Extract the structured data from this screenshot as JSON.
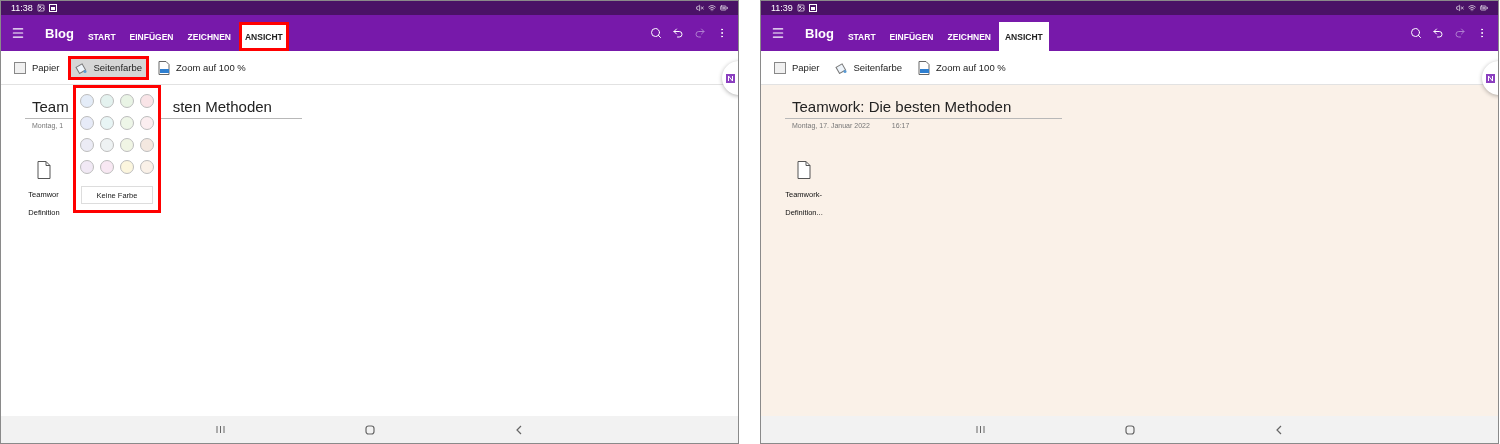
{
  "screens": [
    {
      "status_bar": {
        "time": "11:38"
      },
      "app_bar": {
        "title": "Blog",
        "tabs": [
          {
            "label": "START",
            "selected": false,
            "highlighted": false
          },
          {
            "label": "EINFÜGEN",
            "selected": false,
            "highlighted": false
          },
          {
            "label": "ZEICHNEN",
            "selected": false,
            "highlighted": false
          },
          {
            "label": "ANSICHT",
            "selected": true,
            "highlighted": true
          }
        ],
        "actions": [
          {
            "kind": "search",
            "disabled": false
          },
          {
            "kind": "undo",
            "disabled": false
          },
          {
            "kind": "redo",
            "disabled": true
          },
          {
            "kind": "more",
            "disabled": false
          }
        ]
      },
      "ribbon": [
        {
          "kind": "paper",
          "label": "Papier",
          "highlighted": false
        },
        {
          "kind": "page_color",
          "label": "Seitenfarbe",
          "highlighted": true
        },
        {
          "kind": "zoom",
          "label": "Zoom auf 100 %",
          "highlighted": false
        }
      ],
      "page": {
        "color": "#ffffff",
        "title_segments": [
          "Team",
          "sten Methoden"
        ],
        "date": "Montag, 1",
        "attachment": {
          "lines": [
            "Teamwor",
            "Definition"
          ]
        }
      },
      "color_popup": {
        "highlighted": true,
        "button": "Keine Farbe",
        "swatches": [
          {
            "color": "#e4ecf8"
          },
          {
            "color": "#e4f2ef"
          },
          {
            "color": "#e9f4e5"
          },
          {
            "color": "#f9e4e7"
          },
          {
            "color": "#e7ebf8"
          },
          {
            "color": "#e8f5f5"
          },
          {
            "color": "#eef6e8"
          },
          {
            "color": "#fbeef0"
          },
          {
            "color": "#ebebf5"
          },
          {
            "color": "#eef2f3"
          },
          {
            "color": "#f0f5e4"
          },
          {
            "color": "#f4e8e0"
          },
          {
            "color": "#f1e9f5"
          },
          {
            "color": "#f8e8f3"
          },
          {
            "color": "#fcf6de"
          },
          {
            "color": "#faf1e8"
          }
        ]
      }
    },
    {
      "status_bar": {
        "time": "11:39"
      },
      "app_bar": {
        "title": "Blog",
        "tabs": [
          {
            "label": "START",
            "selected": false,
            "highlighted": false
          },
          {
            "label": "EINFÜGEN",
            "selected": false,
            "highlighted": false
          },
          {
            "label": "ZEICHNEN",
            "selected": false,
            "highlighted": false
          },
          {
            "label": "ANSICHT",
            "selected": true,
            "highlighted": false
          }
        ],
        "actions": [
          {
            "kind": "search",
            "disabled": false
          },
          {
            "kind": "undo",
            "disabled": false
          },
          {
            "kind": "redo",
            "disabled": true
          },
          {
            "kind": "more",
            "disabled": false
          }
        ]
      },
      "ribbon": [
        {
          "kind": "paper",
          "label": "Papier",
          "highlighted": false
        },
        {
          "kind": "page_color",
          "label": "Seitenfarbe",
          "highlighted": false
        },
        {
          "kind": "zoom",
          "label": "Zoom auf 100 %",
          "highlighted": false
        }
      ],
      "page": {
        "color": "#faf1e8",
        "title_segments": [
          "Teamwork: Die besten Methoden"
        ],
        "date": "Montag, 17. Januar 2022",
        "time": "16:17",
        "attachment": {
          "lines": [
            "Teamwork-",
            "Definition..."
          ]
        }
      }
    }
  ]
}
